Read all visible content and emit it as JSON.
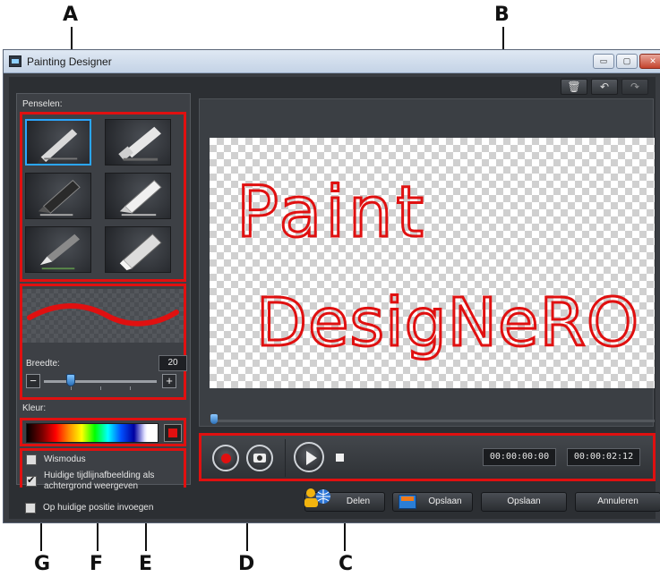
{
  "window": {
    "title": "Painting Designer"
  },
  "titlebar_buttons": {
    "minimize": "▭",
    "maximize": "▢",
    "close": "✕"
  },
  "left_panel": {
    "brushes_label": "Penselen:",
    "width_label": "Breedte:",
    "width_value": "20",
    "minus": "−",
    "plus": "+",
    "color_label": "Kleur:",
    "selected_color": "#e01010",
    "options": [
      {
        "label": "Wismodus",
        "checked": false
      },
      {
        "label": "Huidige tijdlijnafbeelding als achtergrond weergeven",
        "checked": true
      },
      {
        "label": "Op huidige positie invoegen",
        "checked": false
      }
    ]
  },
  "canvas": {
    "text_line1": "Paint",
    "text_line2": "DesigNeRO",
    "ink_color": "#e01010"
  },
  "toolbar": {
    "delete_icon": "trash-icon",
    "undo_icon": "undo-icon",
    "redo_icon": "redo-icon"
  },
  "playback": {
    "current_time": "00:00:00:00",
    "total_time": "00:00:02:12"
  },
  "buttons": {
    "share": "Delen",
    "save_as": "Opslaan",
    "save": "Opslaan",
    "cancel": "Annuleren"
  },
  "callouts": [
    "A",
    "B",
    "C",
    "D",
    "E",
    "F",
    "G"
  ],
  "colors": {
    "highlight": "#e01010",
    "selection": "#2aa6ff"
  }
}
